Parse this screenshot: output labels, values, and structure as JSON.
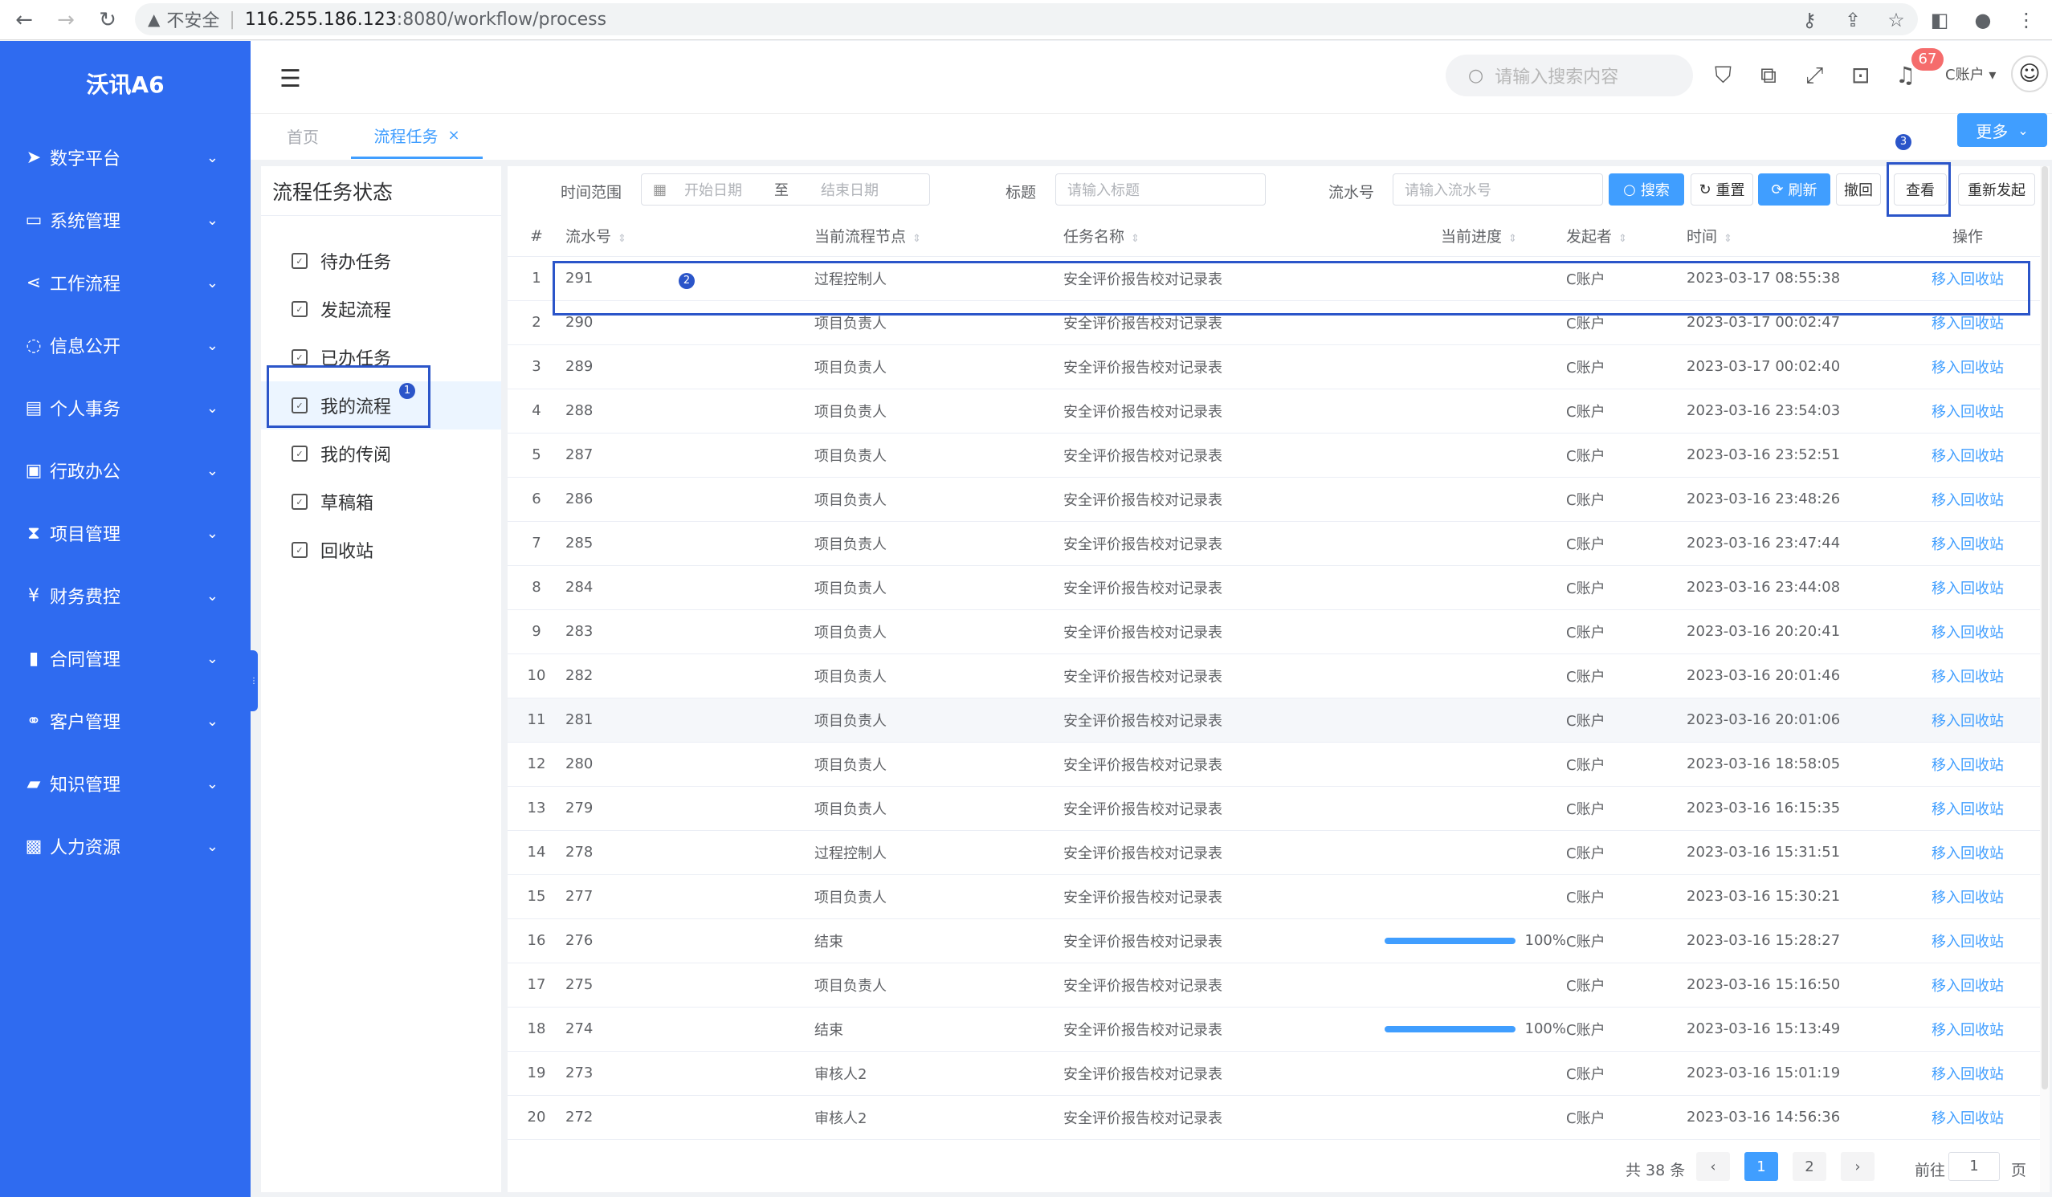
{
  "browser": {
    "insecure_label": "不安全",
    "url_host": "116.255.186.123",
    "url_path": ":8080/workflow/process"
  },
  "app": {
    "logo": "沃讯A6"
  },
  "sidebar": {
    "items": [
      {
        "label": "数字平台",
        "icon": "send-icon"
      },
      {
        "label": "系统管理",
        "icon": "monitor-icon"
      },
      {
        "label": "工作流程",
        "icon": "share-icon"
      },
      {
        "label": "信息公开",
        "icon": "chat-icon"
      },
      {
        "label": "个人事务",
        "icon": "id-card-icon"
      },
      {
        "label": "行政办公",
        "icon": "briefcase-icon"
      },
      {
        "label": "项目管理",
        "icon": "hourglass-icon"
      },
      {
        "label": "财务费控",
        "icon": "yen-icon"
      },
      {
        "label": "合同管理",
        "icon": "file-icon"
      },
      {
        "label": "客户管理",
        "icon": "handshake-icon"
      },
      {
        "label": "知识管理",
        "icon": "book-icon"
      },
      {
        "label": "人力资源",
        "icon": "user-card-icon"
      }
    ]
  },
  "header": {
    "search_placeholder": "请输入搜索内容",
    "notification_count": "67",
    "account_label": "C账户"
  },
  "tabs": {
    "home": "首页",
    "active": "流程任务",
    "more": "更多"
  },
  "markers": {
    "m1": "1",
    "m2": "2",
    "m3": "3"
  },
  "left_panel": {
    "title": "流程任务状态",
    "items": [
      "待办任务",
      "发起流程",
      "已办任务",
      "我的流程",
      "我的传阅",
      "草稿箱",
      "回收站"
    ]
  },
  "filter": {
    "time_range_label": "时间范围",
    "start_placeholder": "开始日期",
    "to": "至",
    "end_placeholder": "结束日期",
    "title_label": "标题",
    "title_placeholder": "请输入标题",
    "serial_label": "流水号",
    "serial_placeholder": "请输入流水号",
    "search_btn": "搜索",
    "reset_btn": "重置",
    "refresh_btn": "刷新",
    "withdraw_btn": "撤回",
    "view_btn": "查看",
    "restart_btn": "重新发起"
  },
  "table": {
    "headers": {
      "index": "#",
      "serial": "流水号",
      "node": "当前流程节点",
      "task": "任务名称",
      "progress": "当前进度",
      "initiator": "发起者",
      "time": "时间",
      "op": "操作"
    },
    "rows": [
      {
        "i": "1",
        "serial": "291",
        "node": "过程控制人",
        "task": "安全评价报告校对记录表",
        "progress": "",
        "initiator": "C账户",
        "time": "2023-03-17 08:55:38",
        "op": "移入回收站"
      },
      {
        "i": "2",
        "serial": "290",
        "node": "项目负责人",
        "task": "安全评价报告校对记录表",
        "progress": "",
        "initiator": "C账户",
        "time": "2023-03-17 00:02:47",
        "op": "移入回收站"
      },
      {
        "i": "3",
        "serial": "289",
        "node": "项目负责人",
        "task": "安全评价报告校对记录表",
        "progress": "",
        "initiator": "C账户",
        "time": "2023-03-17 00:02:40",
        "op": "移入回收站"
      },
      {
        "i": "4",
        "serial": "288",
        "node": "项目负责人",
        "task": "安全评价报告校对记录表",
        "progress": "",
        "initiator": "C账户",
        "time": "2023-03-16 23:54:03",
        "op": "移入回收站"
      },
      {
        "i": "5",
        "serial": "287",
        "node": "项目负责人",
        "task": "安全评价报告校对记录表",
        "progress": "",
        "initiator": "C账户",
        "time": "2023-03-16 23:52:51",
        "op": "移入回收站"
      },
      {
        "i": "6",
        "serial": "286",
        "node": "项目负责人",
        "task": "安全评价报告校对记录表",
        "progress": "",
        "initiator": "C账户",
        "time": "2023-03-16 23:48:26",
        "op": "移入回收站"
      },
      {
        "i": "7",
        "serial": "285",
        "node": "项目负责人",
        "task": "安全评价报告校对记录表",
        "progress": "",
        "initiator": "C账户",
        "time": "2023-03-16 23:47:44",
        "op": "移入回收站"
      },
      {
        "i": "8",
        "serial": "284",
        "node": "项目负责人",
        "task": "安全评价报告校对记录表",
        "progress": "",
        "initiator": "C账户",
        "time": "2023-03-16 23:44:08",
        "op": "移入回收站"
      },
      {
        "i": "9",
        "serial": "283",
        "node": "项目负责人",
        "task": "安全评价报告校对记录表",
        "progress": "",
        "initiator": "C账户",
        "time": "2023-03-16 20:20:41",
        "op": "移入回收站"
      },
      {
        "i": "10",
        "serial": "282",
        "node": "项目负责人",
        "task": "安全评价报告校对记录表",
        "progress": "",
        "initiator": "C账户",
        "time": "2023-03-16 20:01:46",
        "op": "移入回收站"
      },
      {
        "i": "11",
        "serial": "281",
        "node": "项目负责人",
        "task": "安全评价报告校对记录表",
        "progress": "",
        "initiator": "C账户",
        "time": "2023-03-16 20:01:06",
        "op": "移入回收站"
      },
      {
        "i": "12",
        "serial": "280",
        "node": "项目负责人",
        "task": "安全评价报告校对记录表",
        "progress": "",
        "initiator": "C账户",
        "time": "2023-03-16 18:58:05",
        "op": "移入回收站"
      },
      {
        "i": "13",
        "serial": "279",
        "node": "项目负责人",
        "task": "安全评价报告校对记录表",
        "progress": "",
        "initiator": "C账户",
        "time": "2023-03-16 16:15:35",
        "op": "移入回收站"
      },
      {
        "i": "14",
        "serial": "278",
        "node": "过程控制人",
        "task": "安全评价报告校对记录表",
        "progress": "",
        "initiator": "C账户",
        "time": "2023-03-16 15:31:51",
        "op": "移入回收站"
      },
      {
        "i": "15",
        "serial": "277",
        "node": "项目负责人",
        "task": "安全评价报告校对记录表",
        "progress": "",
        "initiator": "C账户",
        "time": "2023-03-16 15:30:21",
        "op": "移入回收站"
      },
      {
        "i": "16",
        "serial": "276",
        "node": "结束",
        "task": "安全评价报告校对记录表",
        "progress": "100%",
        "initiator": "C账户",
        "time": "2023-03-16 15:28:27",
        "op": "移入回收站"
      },
      {
        "i": "17",
        "serial": "275",
        "node": "项目负责人",
        "task": "安全评价报告校对记录表",
        "progress": "",
        "initiator": "C账户",
        "time": "2023-03-16 15:16:50",
        "op": "移入回收站"
      },
      {
        "i": "18",
        "serial": "274",
        "node": "结束",
        "task": "安全评价报告校对记录表",
        "progress": "100%",
        "initiator": "C账户",
        "time": "2023-03-16 15:13:49",
        "op": "移入回收站"
      },
      {
        "i": "19",
        "serial": "273",
        "node": "审核人2",
        "task": "安全评价报告校对记录表",
        "progress": "",
        "initiator": "C账户",
        "time": "2023-03-16 15:01:19",
        "op": "移入回收站"
      },
      {
        "i": "20",
        "serial": "272",
        "node": "审核人2",
        "task": "安全评价报告校对记录表",
        "progress": "",
        "initiator": "C账户",
        "time": "2023-03-16 14:56:36",
        "op": "移入回收站"
      }
    ]
  },
  "pager": {
    "total": "共 38 条",
    "prev": "‹",
    "pages": [
      "1",
      "2"
    ],
    "next": "›",
    "goto": "前往",
    "goto_value": "1",
    "page_unit": "页"
  },
  "colors": {
    "sidebar": "#2f6bf0",
    "primary": "#409eff",
    "annotation": "#2b55c9",
    "badge": "#f56c6c"
  }
}
